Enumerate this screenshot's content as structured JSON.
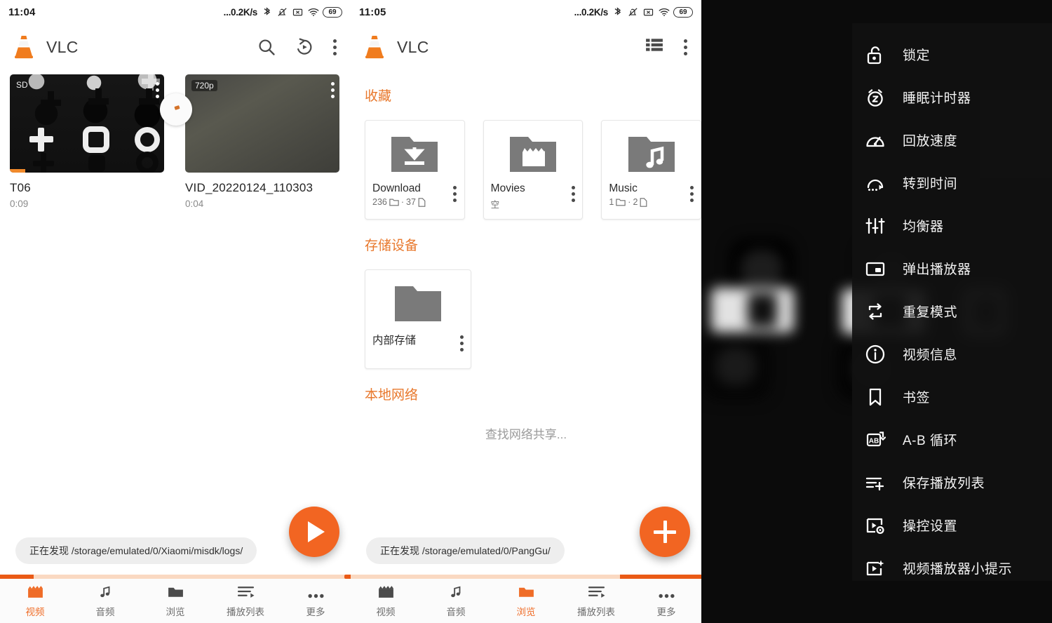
{
  "panels": {
    "video_tab": {
      "status": {
        "time": "11:04",
        "network": "...0.2K/s",
        "battery": "69"
      },
      "appbar": {
        "title": "VLC",
        "actions": [
          "search-icon",
          "history-icon",
          "overflow-icon"
        ]
      },
      "videos": [
        {
          "title": "T06",
          "duration": "0:09",
          "badge": "SD",
          "progress_pct": 10
        },
        {
          "title": "VID_20220124_110303",
          "duration": "0:04",
          "badge": "720p",
          "progress_pct": 0
        }
      ],
      "toast": "正在发现 /storage/emulated/0/Xiaomi/misdk/logs/",
      "fab": "play-icon",
      "progress": {
        "start_pct": 0,
        "end_pct": 9.6,
        "dot_pct": 98.6
      },
      "nav": [
        {
          "label": "视频",
          "icon": "clapperboard-icon",
          "active": true
        },
        {
          "label": "音频",
          "icon": "music-note-icon",
          "active": false
        },
        {
          "label": "浏览",
          "icon": "folder-icon",
          "active": false
        },
        {
          "label": "播放列表",
          "icon": "playlist-icon",
          "active": false
        },
        {
          "label": "更多",
          "icon": "more-icon",
          "active": false
        }
      ]
    },
    "browse_tab": {
      "status": {
        "time": "11:05",
        "network": "...0.2K/s",
        "battery": "69"
      },
      "appbar": {
        "title": "VLC",
        "actions": [
          "list-view-icon",
          "overflow-icon"
        ]
      },
      "sections": [
        {
          "title": "收藏",
          "cards": [
            {
              "name": "Download",
              "icon": "folder-download-icon",
              "counts": {
                "folders": "236",
                "files": "37"
              }
            },
            {
              "name": "Movies",
              "icon": "folder-movie-icon",
              "empty_label": "空"
            },
            {
              "name": "Music",
              "icon": "folder-music-icon",
              "counts": {
                "folders": "1",
                "files": "2"
              }
            }
          ]
        },
        {
          "title": "存储设备",
          "cards": [
            {
              "name": "内部存储",
              "icon": "folder-icon"
            }
          ]
        },
        {
          "title": "本地网络",
          "empty_text": "查找网络共享..."
        }
      ],
      "toast": "正在发现 /storage/emulated/0/PangGu/",
      "fab": "plus-icon",
      "progress": {
        "start_pct": 76.8,
        "end_pct": 100
      },
      "nav": [
        {
          "label": "视频",
          "icon": "clapperboard-icon",
          "active": false
        },
        {
          "label": "音频",
          "icon": "music-note-icon",
          "active": false
        },
        {
          "label": "浏览",
          "icon": "folder-icon",
          "active": true
        },
        {
          "label": "播放列表",
          "icon": "playlist-icon",
          "active": false
        },
        {
          "label": "更多",
          "icon": "more-icon",
          "active": false
        }
      ]
    },
    "player_menu": {
      "items": [
        {
          "label": "锁定",
          "icon": "lock-open-icon"
        },
        {
          "label": "睡眠计时器",
          "icon": "sleep-timer-icon"
        },
        {
          "label": "回放速度",
          "icon": "speedometer-icon"
        },
        {
          "label": "转到时间",
          "icon": "jump-to-time-icon"
        },
        {
          "label": "均衡器",
          "icon": "equalizer-icon"
        },
        {
          "label": "弹出播放器",
          "icon": "popup-player-icon"
        },
        {
          "label": "重复模式",
          "icon": "repeat-icon"
        },
        {
          "label": "视频信息",
          "icon": "info-icon"
        },
        {
          "label": "书签",
          "icon": "bookmark-icon"
        },
        {
          "label": "A-B 循环",
          "icon": "ab-repeat-icon"
        },
        {
          "label": "保存播放列表",
          "icon": "playlist-add-icon"
        },
        {
          "label": "操控设置",
          "icon": "player-settings-icon"
        },
        {
          "label": "视频播放器小提示",
          "icon": "video-tips-icon"
        }
      ]
    }
  },
  "colors": {
    "accent": "#f26522",
    "accent_dark": "#ea5a16",
    "track": "#fad9c2",
    "menu_bg": "#111111"
  }
}
